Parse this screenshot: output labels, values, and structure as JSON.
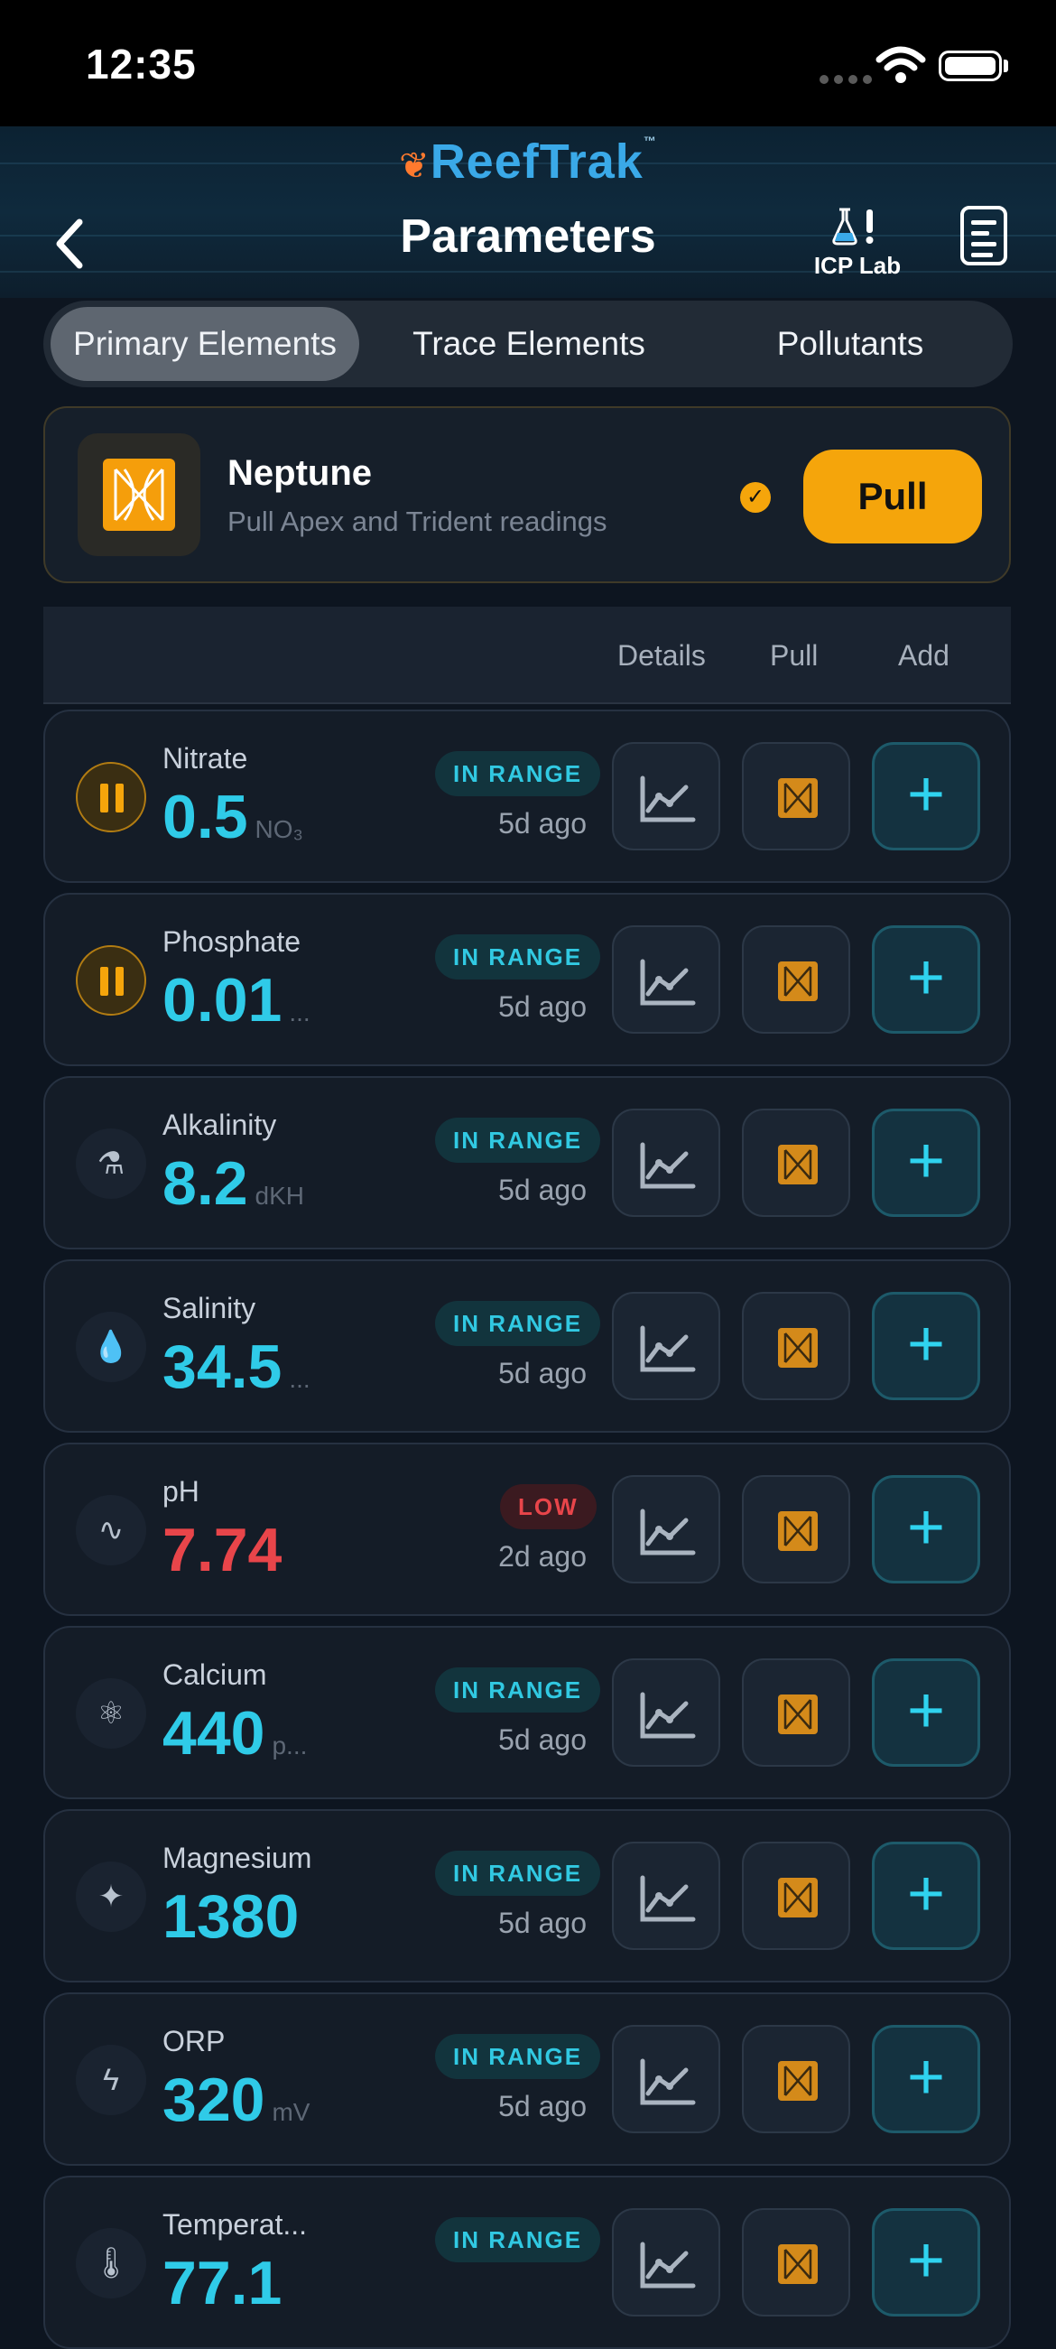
{
  "status_bar": {
    "time": "12:35"
  },
  "header": {
    "brand": "ReefTrak",
    "title": "Parameters",
    "icp_label": "ICP Lab"
  },
  "tabs": [
    {
      "label": "Primary Elements",
      "active": true
    },
    {
      "label": "Trace Elements",
      "active": false
    },
    {
      "label": "Pollutants",
      "active": false
    }
  ],
  "neptune": {
    "name": "Neptune",
    "subtitle": "Pull Apex and Trident readings",
    "pull_label": "Pull"
  },
  "columns": {
    "details": "Details",
    "pull": "Pull",
    "add": "Add"
  },
  "rows": [
    {
      "name": "Nitrate",
      "value": "0.5",
      "unit": "NO₃",
      "status": "IN RANGE",
      "ago": "5d ago",
      "icon": "pause-icon"
    },
    {
      "name": "Phosphate",
      "value": "0.01",
      "unit": "...",
      "status": "IN RANGE",
      "ago": "5d ago",
      "icon": "pause-icon"
    },
    {
      "name": "Alkalinity",
      "value": "8.2",
      "unit": "dKH",
      "status": "IN RANGE",
      "ago": "5d ago",
      "icon": "flask-icon"
    },
    {
      "name": "Salinity",
      "value": "34.5",
      "unit": "...",
      "status": "IN RANGE",
      "ago": "5d ago",
      "icon": "drop-icon"
    },
    {
      "name": "pH",
      "value": "7.74",
      "unit": "",
      "status": "LOW",
      "ago": "2d ago",
      "icon": "waveform-icon"
    },
    {
      "name": "Calcium",
      "value": "440",
      "unit": "p...",
      "status": "IN RANGE",
      "ago": "5d ago",
      "icon": "atom-icon"
    },
    {
      "name": "Magnesium",
      "value": "1380",
      "unit": "",
      "status": "IN RANGE",
      "ago": "5d ago",
      "icon": "sparkle-icon"
    },
    {
      "name": "ORP",
      "value": "320",
      "unit": "mV",
      "status": "IN RANGE",
      "ago": "5d ago",
      "icon": "bolt-icon"
    },
    {
      "name": "Temperat...",
      "value": "77.1",
      "unit": "",
      "status": "IN RANGE",
      "ago": "",
      "icon": "thermometer-icon"
    }
  ],
  "colors": {
    "accent": "#2fcbe8",
    "warning": "#f5a50b",
    "low": "#e8454a",
    "background": "#0d1520"
  }
}
